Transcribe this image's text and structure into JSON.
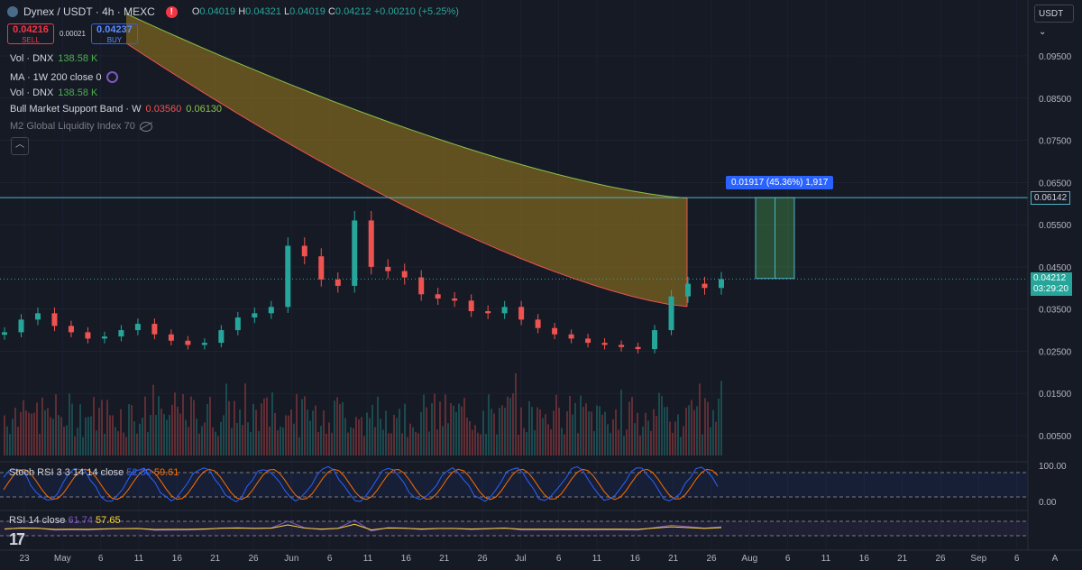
{
  "header": {
    "pair": "Dynex / USDT · 4h · MEXC",
    "alert": "!",
    "ohlc": {
      "o_label": "O",
      "o": "0.04019",
      "h_label": "H",
      "h": "0.04321",
      "l_label": "L",
      "l": "0.04019",
      "c_label": "C",
      "c": "0.04212",
      "change": "+0.00210 (+5.25%)"
    }
  },
  "trade": {
    "sell_price": "0.04216",
    "sell_label": "SELL",
    "spread": "0.00021",
    "buy_price": "0.04237",
    "buy_label": "BUY"
  },
  "indicators": [
    {
      "name": "Vol · DNX",
      "value": "138.58 K"
    },
    {
      "name": "MA · 1W 200 close 0",
      "value": ""
    },
    {
      "name": "Vol · DNX",
      "value": "138.58 K"
    },
    {
      "name": "Bull Market Support Band · W",
      "value1": "0.03560",
      "value2": "0.06130"
    },
    {
      "name": "M2 Global Liquidity Index 70",
      "value": ""
    }
  ],
  "quote_selector": "USDT",
  "subpanes": {
    "stoch": {
      "name": "Stoch RSI 3 3 14 14 close",
      "k": "52.80",
      "d": "59.61"
    },
    "rsi": {
      "name": "RSI 14 close",
      "rsi": "61.74",
      "ma": "57.65"
    }
  },
  "measure": {
    "text": "0.01917 (45.36%) 1,917"
  },
  "price_tags": {
    "level": "0.06142",
    "last": "0.04212",
    "countdown": "03:29:20"
  },
  "colors": {
    "bg": "#161a25",
    "up": "#26a69a",
    "down": "#ef5350",
    "band_fill": "#a07d1e",
    "band_upper": "#8bc34a",
    "band_lower": "#ef5350",
    "accent": "#2962ff",
    "stoch_k": "#2962ff",
    "stoch_d": "#ff6d00",
    "rsi": "#7e57c2",
    "rsi_ma": "#fdd835"
  },
  "chart_data": {
    "type": "candlestick",
    "timeframe": "4h",
    "y_ticks": [
      "0.09500",
      "0.08500",
      "0.07500",
      "0.06500",
      "0.05500",
      "0.04500",
      "0.03500",
      "0.02500",
      "0.01500",
      "0.00500"
    ],
    "x_ticks": [
      "23",
      "May",
      "6",
      "11",
      "16",
      "21",
      "26",
      "Jun",
      "6",
      "11",
      "16",
      "21",
      "26",
      "Jul",
      "6",
      "11",
      "16",
      "21",
      "26",
      "Aug",
      "6",
      "11",
      "16",
      "21",
      "26",
      "Sep",
      "6",
      "A"
    ],
    "stoch_ticks": [
      "100.00",
      "0.00"
    ],
    "close_approx": [
      0.0295,
      0.0325,
      0.034,
      0.031,
      0.0295,
      0.028,
      0.0285,
      0.03,
      0.0315,
      0.029,
      0.0275,
      0.0265,
      0.027,
      0.03,
      0.033,
      0.034,
      0.0355,
      0.05,
      0.0475,
      0.042,
      0.0405,
      0.056,
      0.045,
      0.044,
      0.0425,
      0.0385,
      0.0375,
      0.037,
      0.0345,
      0.034,
      0.0355,
      0.0325,
      0.0305,
      0.029,
      0.028,
      0.027,
      0.0265,
      0.026,
      0.0255,
      0.03,
      0.038,
      0.041,
      0.04,
      0.0421
    ],
    "bull_band": {
      "upper_start": 0.105,
      "upper_end": 0.0613,
      "lower_start": 0.098,
      "lower_end": 0.0356
    },
    "level": 0.06142,
    "last": 0.04212,
    "measure": {
      "from": 0.04225,
      "to": 0.06142,
      "change": "0.01917",
      "pct": "45.36%",
      "ticks": "1,917"
    }
  }
}
